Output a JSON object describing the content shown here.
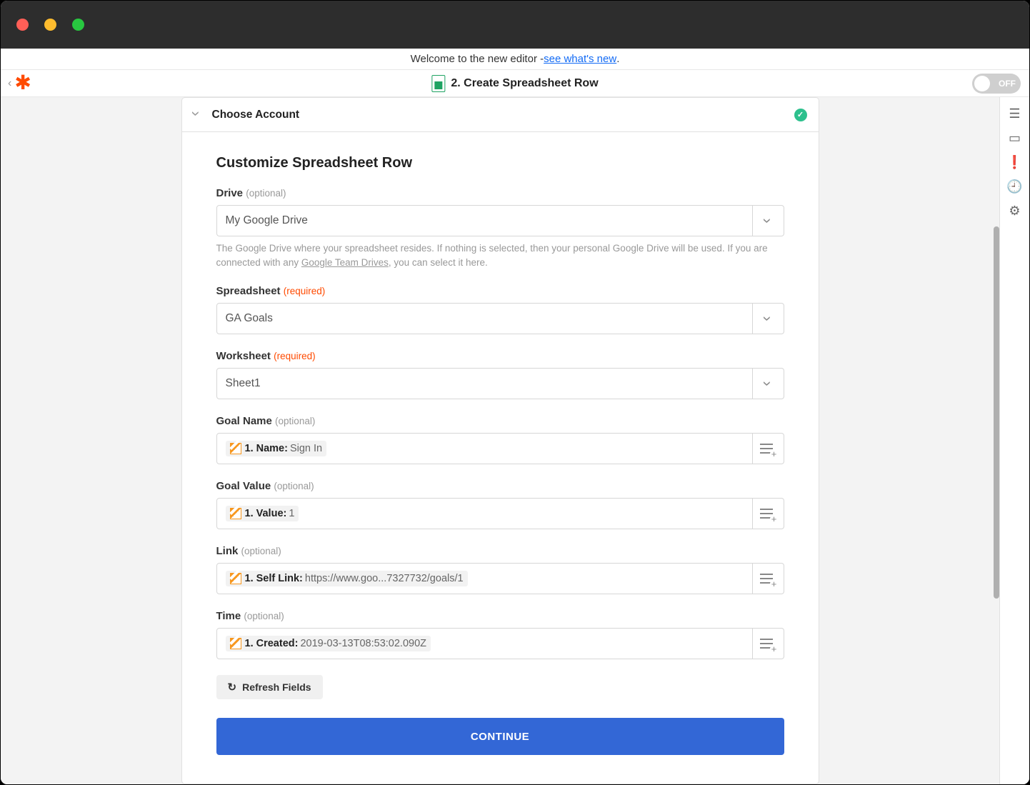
{
  "welcome": {
    "prefix": "Welcome to the new editor - ",
    "link": "see what's new",
    "suffix": "."
  },
  "header": {
    "title": "2. Create Spreadsheet Row",
    "toggle": "OFF"
  },
  "section": {
    "collapsed": "Choose Account",
    "heading": "Customize Spreadsheet Row"
  },
  "fields": {
    "drive": {
      "label": "Drive",
      "tag": "(optional)",
      "value": "My Google Drive",
      "help_prefix": "The Google Drive where your spreadsheet resides. If nothing is selected, then your personal Google Drive will be used. If you are connected with any ",
      "help_link": "Google Team Drives",
      "help_suffix": ", you can select it here."
    },
    "spreadsheet": {
      "label": "Spreadsheet",
      "tag": "(required)",
      "value": "GA Goals"
    },
    "worksheet": {
      "label": "Worksheet",
      "tag": "(required)",
      "value": "Sheet1"
    },
    "goalname": {
      "label": "Goal Name",
      "tag": "(optional)",
      "tokenKey": "1. Name:",
      "tokenVal": "Sign In"
    },
    "goalvalue": {
      "label": "Goal Value",
      "tag": "(optional)",
      "tokenKey": "1. Value:",
      "tokenVal": "1"
    },
    "link": {
      "label": "Link",
      "tag": "(optional)",
      "tokenKey": "1. Self Link:",
      "tokenVal": "https://www.goo...7327732/goals/1"
    },
    "time": {
      "label": "Time",
      "tag": "(optional)",
      "tokenKey": "1. Created:",
      "tokenVal": "2019-03-13T08:53:02.090Z"
    }
  },
  "buttons": {
    "refresh": "Refresh Fields",
    "continue": "CONTINUE"
  }
}
